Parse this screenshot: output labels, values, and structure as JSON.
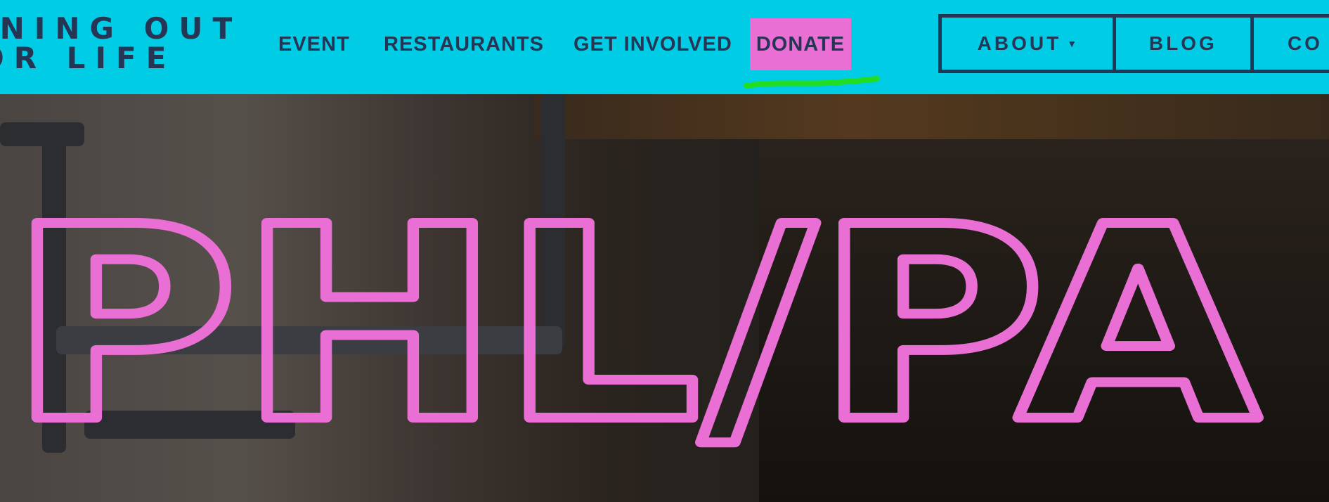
{
  "header": {
    "logo_line1": "INING OUT",
    "logo_line2": "OR LIFE",
    "nav": [
      {
        "label": "EVENT"
      },
      {
        "label": "RESTAURANTS"
      },
      {
        "label": "GET INVOLVED"
      },
      {
        "label": "DONATE"
      }
    ],
    "buttons": [
      {
        "label": "ABOUT"
      },
      {
        "label": "BLOG"
      },
      {
        "label": "CO"
      }
    ]
  },
  "hero": {
    "headline": "PHL/PA"
  },
  "colors": {
    "header_bg": "#00cce5",
    "nav_text": "#263554",
    "donate_bg": "#ea6fd4",
    "highlight_mark": "#22dd22",
    "headline_outline": "#ea6fd4"
  },
  "icons": {
    "about_dropdown": "caret-down-icon"
  }
}
